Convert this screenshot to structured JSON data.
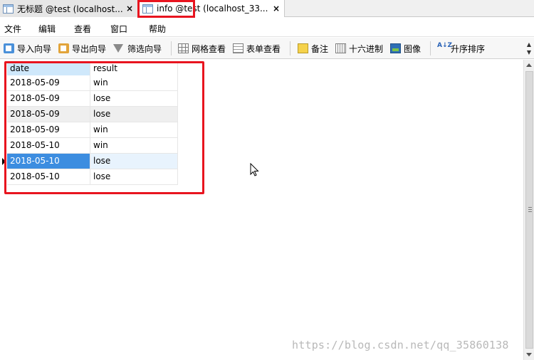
{
  "tabs": [
    {
      "label": "无标题 @test (localhost...",
      "close": "×",
      "active": false
    },
    {
      "label": "info @test (localhost_33...",
      "close": "×",
      "active": true
    }
  ],
  "menu": [
    "文件",
    "编辑",
    "查看",
    "窗口",
    "帮助"
  ],
  "toolbar": {
    "import": "导入向导",
    "export": "导出向导",
    "filter": "筛选向导",
    "grid_view": "网格查看",
    "form_view": "表单查看",
    "note": "备注",
    "hex": "十六进制",
    "image": "图像",
    "sort_icon": "A↓Z",
    "sort": "升序排序"
  },
  "table": {
    "columns": [
      "date",
      "result"
    ],
    "rows": [
      [
        "2018-05-09",
        "win"
      ],
      [
        "2018-05-09",
        "lose"
      ],
      [
        "2018-05-09",
        "lose"
      ],
      [
        "2018-05-09",
        "win"
      ],
      [
        "2018-05-10",
        "win"
      ],
      [
        "2018-05-10",
        "lose"
      ],
      [
        "2018-05-10",
        "lose"
      ]
    ],
    "selected_row": 5
  },
  "watermark": "https://blog.csdn.net/qq_35860138",
  "colors": {
    "highlight_box": "#e8141f",
    "selection": "#3c8de0"
  }
}
